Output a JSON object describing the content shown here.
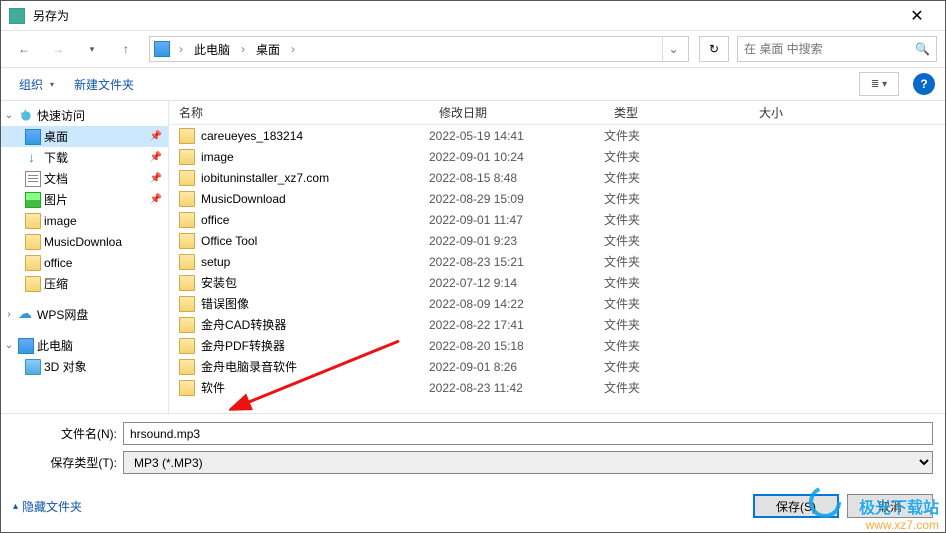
{
  "window": {
    "title": "另存为"
  },
  "nav": {
    "crumb1": "此电脑",
    "crumb2": "桌面",
    "search_placeholder": "在 桌面 中搜索"
  },
  "toolbar": {
    "organize": "组织",
    "newfolder": "新建文件夹"
  },
  "sidebar": {
    "quick": "快速访问",
    "desktop": "桌面",
    "download": "下载",
    "docs": "文档",
    "pics": "图片",
    "image": "image",
    "musicdl": "MusicDownloa",
    "office": "office",
    "compress": "压缩",
    "wps": "WPS网盘",
    "thispc": "此电脑",
    "obj3d": "3D 对象"
  },
  "columns": {
    "name": "名称",
    "date": "修改日期",
    "type": "类型",
    "size": "大小"
  },
  "files": [
    {
      "name": "careueyes_183214",
      "date": "2022-05-19 14:41",
      "type": "文件夹"
    },
    {
      "name": "image",
      "date": "2022-09-01 10:24",
      "type": "文件夹"
    },
    {
      "name": "iobituninstaller_xz7.com",
      "date": "2022-08-15 8:48",
      "type": "文件夹"
    },
    {
      "name": "MusicDownload",
      "date": "2022-08-29 15:09",
      "type": "文件夹"
    },
    {
      "name": "office",
      "date": "2022-09-01 11:47",
      "type": "文件夹"
    },
    {
      "name": "Office Tool",
      "date": "2022-09-01 9:23",
      "type": "文件夹"
    },
    {
      "name": "setup",
      "date": "2022-08-23 15:21",
      "type": "文件夹"
    },
    {
      "name": "安装包",
      "date": "2022-07-12 9:14",
      "type": "文件夹"
    },
    {
      "name": "错误图像",
      "date": "2022-08-09 14:22",
      "type": "文件夹"
    },
    {
      "name": "金舟CAD转换器",
      "date": "2022-08-22 17:41",
      "type": "文件夹"
    },
    {
      "name": "金舟PDF转换器",
      "date": "2022-08-20 15:18",
      "type": "文件夹"
    },
    {
      "name": "金舟电脑录音软件",
      "date": "2022-09-01 8:26",
      "type": "文件夹"
    },
    {
      "name": "软件",
      "date": "2022-08-23 11:42",
      "type": "文件夹"
    }
  ],
  "form": {
    "filename_label": "文件名(N):",
    "filename_value": "hrsound.mp3",
    "filetype_label": "保存类型(T):",
    "filetype_value": "MP3 (*.MP3)"
  },
  "footer": {
    "hide": "隐藏文件夹",
    "save": "保存(S)",
    "cancel": "取消"
  },
  "watermark": {
    "line1": "极光下载站",
    "line2": "www.xz7.com"
  }
}
